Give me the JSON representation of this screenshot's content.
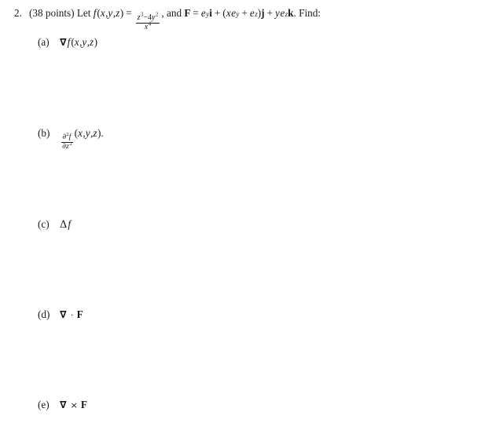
{
  "document": {
    "background_color": "#ffffff",
    "text_color": "#1a1a1a",
    "problem": {
      "number": "2.",
      "points_text": "(38 points)",
      "lead_in": " Let ",
      "function_name": "f",
      "function_args_open": "(",
      "function_var_x": "x",
      "comma1": ", ",
      "function_var_y": "y",
      "comma2": ", ",
      "function_var_z": "z",
      "function_args_close": ")",
      "equals": "=",
      "fraction": {
        "numerator_base1": "z",
        "numerator_exp1": "3",
        "numerator_minus": "−4",
        "numerator_base2": "y",
        "numerator_exp2": "2",
        "denominator_base": "x",
        "denominator_exp": "4"
      },
      "comma_after_fraction": ",",
      "and_text": " and ",
      "field_symbol": "F",
      "field_equals": "=",
      "field_i_base": "e",
      "field_i_exp": "y",
      "field_i_unit": "i",
      "field_plus1": "+",
      "field_j_open": "(",
      "field_j_x": "x",
      "field_j_base1": "e",
      "field_j_exp1": "y",
      "field_j_plus": "+",
      "field_j_base2": "e",
      "field_j_exp2": "z",
      "field_j_close": ")",
      "field_j_unit": "j",
      "field_plus2": "+",
      "field_k_y": "y",
      "field_k_base": "e",
      "field_k_exp": "z",
      "field_k_unit": "k",
      "find_text": ". Find:"
    },
    "parts": [
      {
        "id": "a",
        "label": "(a)",
        "operator": "∇",
        "func": "f",
        "args_open": "(",
        "var_x": "x",
        "comma1": ",",
        "var_y": "y",
        "comma2": ",",
        "var_z": "z",
        "args_close": ")",
        "trailing": "",
        "description": "gradient of f"
      },
      {
        "id": "b",
        "label": "(b)",
        "numerator_partial": "∂",
        "numerator_exp": "2",
        "numerator_func": "f",
        "denominator_partial": "∂",
        "denominator_var": "z",
        "denominator_exp": "2",
        "args_open": "(",
        "var_x": "x",
        "comma1": ",",
        "var_y": "y",
        "comma2": ",",
        "var_z": "z",
        "args_close": ")",
        "trailing": ".",
        "description": "second partial derivative of f with respect to z"
      },
      {
        "id": "c",
        "label": "(c)",
        "operator": "Δ",
        "func": "f",
        "description": "Laplacian of f"
      },
      {
        "id": "d",
        "label": "(d)",
        "operator": "∇",
        "connector": "·",
        "field": "F",
        "description": "divergence of F"
      },
      {
        "id": "e",
        "label": "(e)",
        "operator": "∇",
        "connector": "×",
        "field": "F",
        "description": "curl of F"
      }
    ]
  }
}
